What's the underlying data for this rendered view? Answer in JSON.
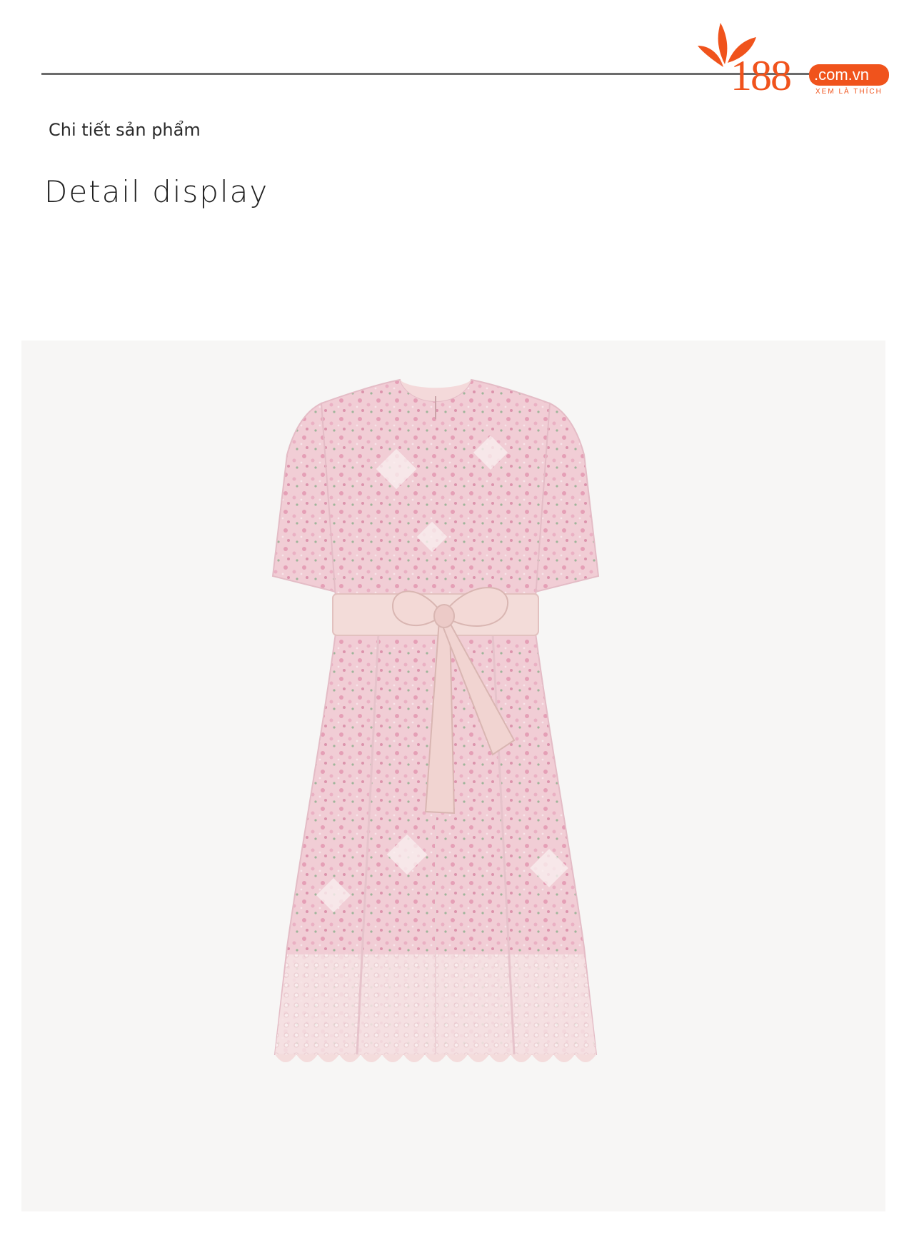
{
  "brand": {
    "logo_number": "188",
    "logo_domain": ".com.vn",
    "logo_tagline": "XEM LÀ THÍCH",
    "accent_color": "#f0531c"
  },
  "header": {
    "subtitle": "Chi tiết sản phẩm",
    "title": "Detail display"
  },
  "product_image": {
    "alt": "Pink embroidered eyelet short-sleeve dress with waist bow",
    "dress_color": "#f2cfd6",
    "belt_color": "#f3dcd9"
  }
}
